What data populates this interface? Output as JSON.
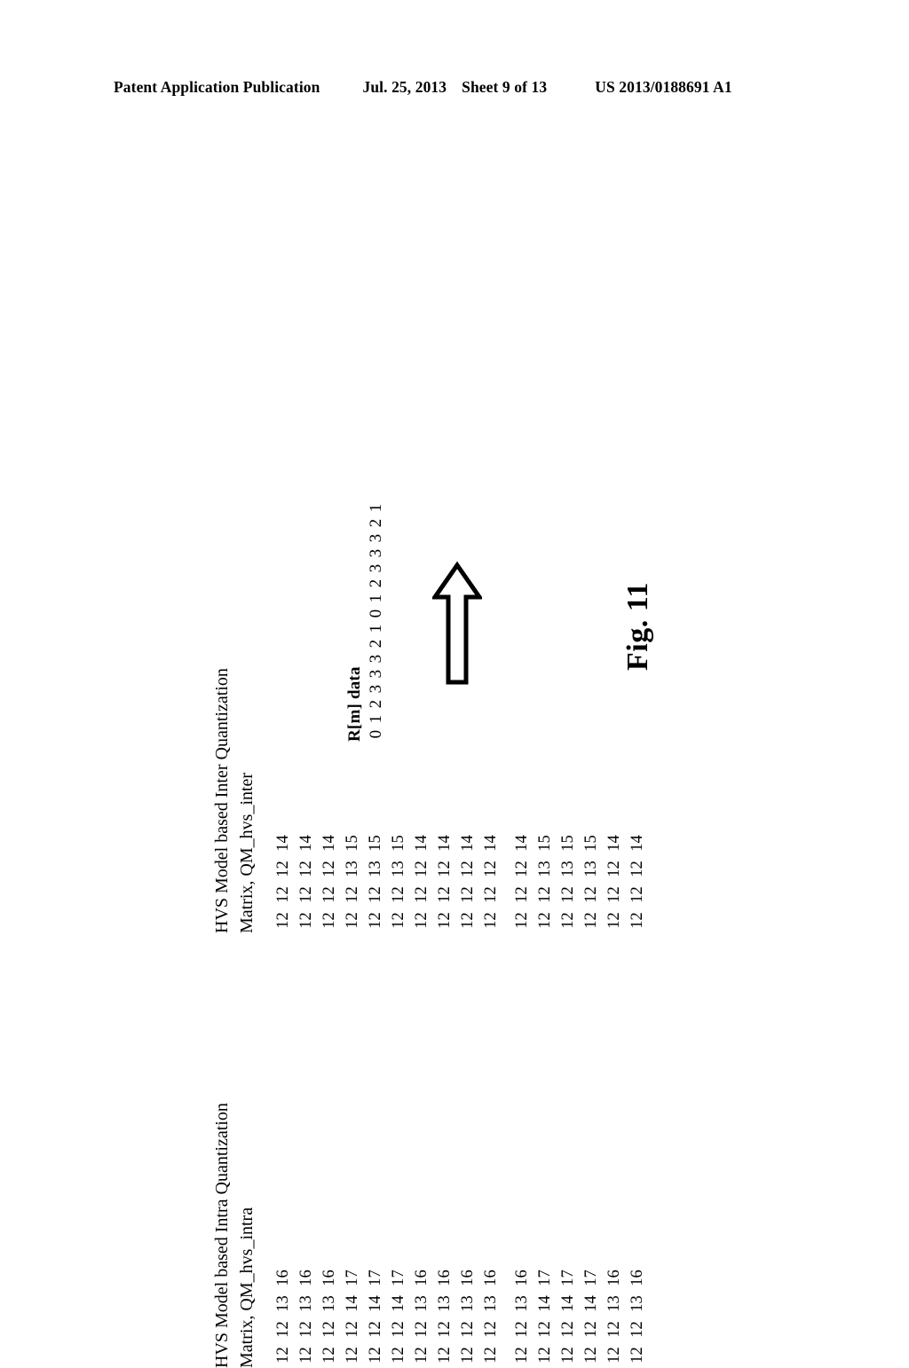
{
  "header": {
    "publication": "Patent Application Publication",
    "date": "Jul. 25, 2013",
    "sheet": "Sheet 9 of 13",
    "publication_number": "US 2013/0188691 A1"
  },
  "figure": {
    "caption": "Fig. 11"
  },
  "intra_matrix": {
    "title_line1": "HVS Model based Intra Quantization",
    "title_line2": "Matrix, QM_hvs_intra",
    "rows": [
      [
        12,
        12,
        13,
        16
      ],
      [
        12,
        12,
        13,
        16
      ],
      [
        12,
        12,
        13,
        16
      ],
      [
        12,
        12,
        14,
        17
      ],
      [
        12,
        12,
        14,
        17
      ],
      [
        12,
        12,
        14,
        17
      ],
      [
        12,
        12,
        13,
        16
      ],
      [
        12,
        12,
        13,
        16
      ],
      [
        12,
        12,
        13,
        16
      ],
      [
        12,
        12,
        13,
        16
      ],
      [
        12,
        12,
        13,
        16
      ],
      [
        12,
        12,
        14,
        17
      ],
      [
        12,
        12,
        14,
        17
      ],
      [
        12,
        12,
        14,
        17
      ],
      [
        12,
        12,
        13,
        16
      ],
      [
        12,
        12,
        13,
        16
      ]
    ]
  },
  "inter_matrix": {
    "title_line1": "HVS Model based Inter Quantization",
    "title_line2": "Matrix, QM_hvs_inter",
    "rows": [
      [
        12,
        12,
        12,
        14
      ],
      [
        12,
        12,
        12,
        14
      ],
      [
        12,
        12,
        12,
        14
      ],
      [
        12,
        12,
        13,
        15
      ],
      [
        12,
        12,
        13,
        15
      ],
      [
        12,
        12,
        13,
        15
      ],
      [
        12,
        12,
        12,
        14
      ],
      [
        12,
        12,
        12,
        14
      ],
      [
        12,
        12,
        12,
        14
      ],
      [
        12,
        12,
        12,
        14
      ],
      [
        12,
        12,
        12,
        14
      ],
      [
        12,
        12,
        13,
        15
      ],
      [
        12,
        12,
        13,
        15
      ],
      [
        12,
        12,
        13,
        15
      ],
      [
        12,
        12,
        12,
        14
      ],
      [
        12,
        12,
        12,
        14
      ]
    ]
  },
  "rm_data": {
    "label": "R[m] data",
    "values": [
      0,
      1,
      2,
      3,
      3,
      3,
      2,
      1,
      0,
      1,
      2,
      3,
      3,
      3,
      2,
      1
    ]
  },
  "arrow": {
    "direction": "up",
    "name": "transform-arrow"
  }
}
